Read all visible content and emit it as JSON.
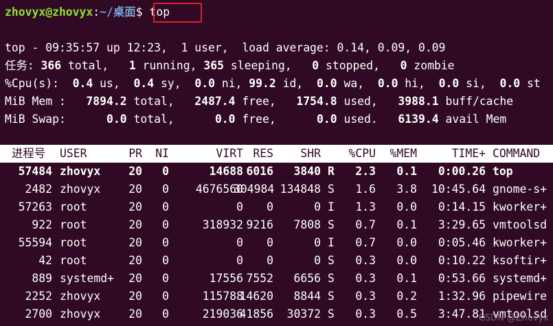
{
  "prompt": {
    "user_host": "zhovyx@zhovyx",
    "colon": ":",
    "path": "~/桌面",
    "dollar": "$ ",
    "command": "top"
  },
  "summary": {
    "line1": "top - 09:35:57 up 12:23,  1 user,  load average: 0.14, 0.09, 0.09",
    "tasks": {
      "label": "任务: ",
      "total": "366",
      "total_label": " total,   ",
      "running": "1",
      "running_label": " running, ",
      "sleeping": "365",
      "sleeping_label": " sleeping,   ",
      "stopped": "0",
      "stopped_label": " stopped,   ",
      "zombie": "0",
      "zombie_label": " zombie"
    },
    "cpu": {
      "label": "%Cpu(s):  ",
      "us": "0.4",
      "us_label": " us,  ",
      "sy": "0.4",
      "sy_label": " sy,  ",
      "ni": "0.0",
      "ni_label": " ni, ",
      "id": "99.2",
      "id_label": " id,  ",
      "wa": "0.0",
      "wa_label": " wa,  ",
      "hi": "0.0",
      "hi_label": " hi,  ",
      "si": "0.0",
      "si_label": " si,  ",
      "st": "0.0",
      "st_label": " st"
    },
    "mem": {
      "label": "MiB Mem :   ",
      "total": "7894.2",
      "total_label": " total,   ",
      "free": "2487.4",
      "free_label": " free,   ",
      "used": "1754.8",
      "used_label": " used,   ",
      "buff": "3988.1",
      "buff_label": " buff/cache"
    },
    "swap": {
      "label": "MiB Swap:      ",
      "total": "0.0",
      "total_label": " total,      ",
      "free": "0.0",
      "free_label": " free,      ",
      "used": "0.0",
      "used_label": " used.   ",
      "avail": "6139.4",
      "avail_label": " avail Mem"
    }
  },
  "columns": [
    "进程号",
    "USER",
    "PR",
    "NI",
    "VIRT",
    "RES",
    "SHR",
    "",
    "%CPU",
    "%MEM",
    "TIME+",
    "COMMAND"
  ],
  "processes": [
    [
      "57484",
      "zhovyx",
      "20",
      "0",
      "14688",
      "6016",
      "3840",
      "R",
      "2.3",
      "0.1",
      "0:00.26",
      "top"
    ],
    [
      "2482",
      "zhovyx",
      "20",
      "0",
      "4676560",
      "304984",
      "134848",
      "S",
      "1.6",
      "3.8",
      "10:45.64",
      "gnome-s+"
    ],
    [
      "57263",
      "root",
      "20",
      "0",
      "0",
      "0",
      "0",
      "I",
      "1.3",
      "0.0",
      "0:14.15",
      "kworker+"
    ],
    [
      "922",
      "root",
      "20",
      "0",
      "318932",
      "9216",
      "7808",
      "S",
      "0.7",
      "0.1",
      "3:29.65",
      "vmtoolsd"
    ],
    [
      "55594",
      "root",
      "20",
      "0",
      "0",
      "0",
      "0",
      "I",
      "0.7",
      "0.0",
      "0:05.46",
      "kworker+"
    ],
    [
      "42",
      "root",
      "20",
      "0",
      "0",
      "0",
      "0",
      "S",
      "0.3",
      "0.0",
      "0:10.22",
      "ksoftir+"
    ],
    [
      "889",
      "systemd+",
      "20",
      "0",
      "17556",
      "7552",
      "6656",
      "S",
      "0.3",
      "0.1",
      "0:53.66",
      "systemd+"
    ],
    [
      "2252",
      "zhovyx",
      "20",
      "0",
      "115788",
      "14620",
      "8844",
      "S",
      "0.3",
      "0.2",
      "1:32.96",
      "pipewire"
    ],
    [
      "2700",
      "zhovyx",
      "20",
      "0",
      "219036",
      "41856",
      "30372",
      "S",
      "0.3",
      "0.5",
      "3:47.81",
      "vmtoolsd"
    ]
  ],
  "watermark": "CSDN @Zhovyx"
}
